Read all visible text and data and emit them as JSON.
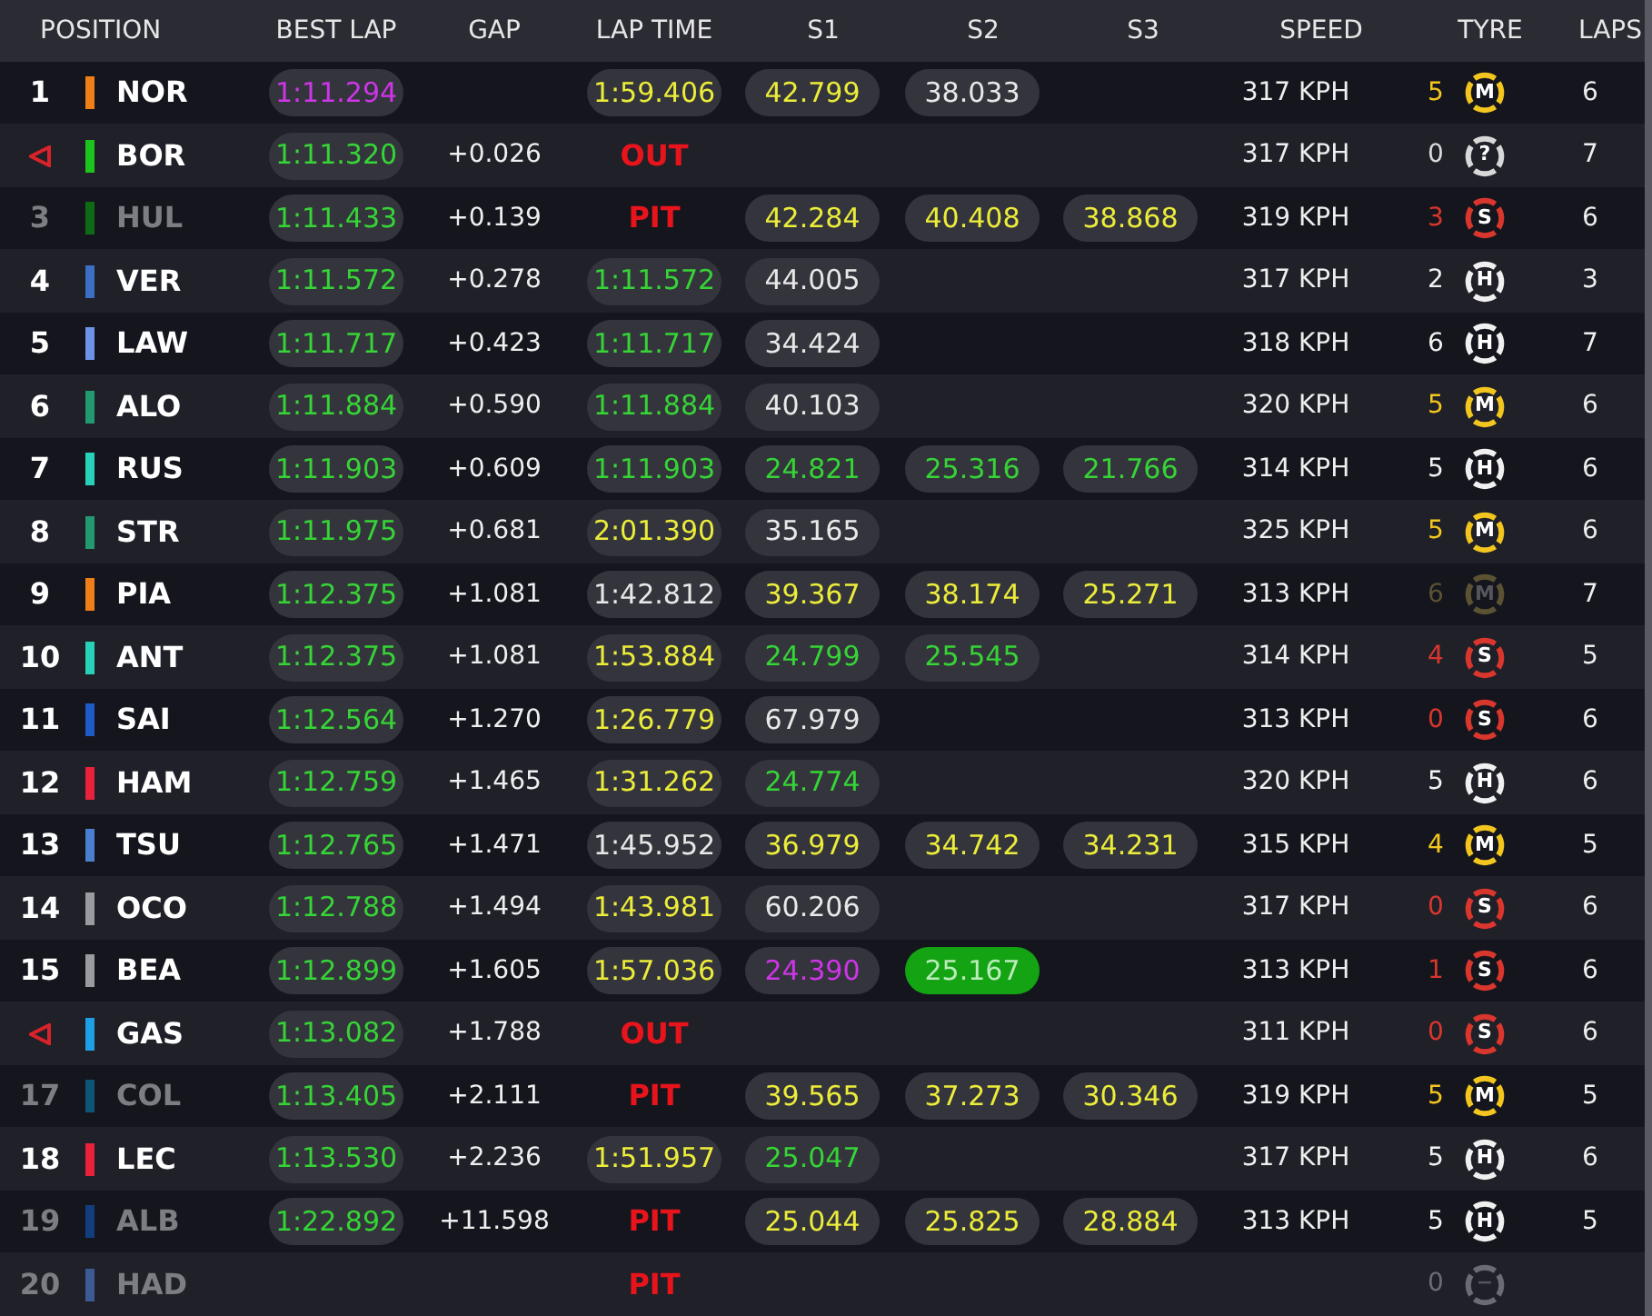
{
  "columns": [
    "POSITION",
    "BEST LAP",
    "GAP",
    "LAP TIME",
    "S1",
    "S2",
    "S3",
    "SPEED",
    "TYRE",
    "LAPS"
  ],
  "rows": [
    {
      "position": {
        "kind": "number",
        "text": "1"
      },
      "color": "#f07f1a",
      "driver": "NOR",
      "dimmed": false,
      "best_lap": {
        "text": "1:11.294",
        "kind": "fastest"
      },
      "lap_time": {
        "kind": "slower",
        "text": "1:59.406"
      },
      "s1": {
        "text": "42.799",
        "kind": "slower",
        "highlighted": false
      },
      "s2": {
        "text": "38.033",
        "kind": "plain",
        "highlighted": false
      },
      "speed": "317 KPH",
      "tyre": {
        "age": "5",
        "letter": "M",
        "color": "#f2c51f",
        "faded": false
      },
      "laps": "6"
    },
    {
      "position": {
        "kind": "triangle"
      },
      "color": "#1ec41e",
      "driver": "BOR",
      "dimmed": false,
      "best_lap": {
        "text": "1:11.320",
        "kind": "personal"
      },
      "gap": "+0.026",
      "lap_time": {
        "kind": "status",
        "text": "OUT"
      },
      "speed": "317 KPH",
      "tyre": {
        "age": "0",
        "letter": "?",
        "color": "#d8d8d8",
        "faded": false
      },
      "laps": "7"
    },
    {
      "position": {
        "kind": "number",
        "text": "3"
      },
      "color": "#0f6a16",
      "driver": "HUL",
      "dimmed": true,
      "best_lap": {
        "text": "1:11.433",
        "kind": "personal"
      },
      "gap": "+0.139",
      "lap_time": {
        "kind": "status",
        "text": "PIT"
      },
      "s1": {
        "text": "42.284",
        "kind": "slower",
        "highlighted": false
      },
      "s2": {
        "text": "40.408",
        "kind": "slower",
        "highlighted": false
      },
      "s3": {
        "text": "38.868",
        "kind": "slower",
        "highlighted": false
      },
      "speed": "319 KPH",
      "tyre": {
        "age": "3",
        "letter": "S",
        "color": "#d9362e",
        "faded": false
      },
      "laps": "6"
    },
    {
      "position": {
        "kind": "number",
        "text": "4"
      },
      "color": "#3c6fc4",
      "driver": "VER",
      "dimmed": false,
      "best_lap": {
        "text": "1:11.572",
        "kind": "personal"
      },
      "gap": "+0.278",
      "lap_time": {
        "kind": "personal",
        "text": "1:11.572"
      },
      "s1": {
        "text": "44.005",
        "kind": "plain",
        "highlighted": false
      },
      "speed": "317 KPH",
      "tyre": {
        "age": "2",
        "letter": "H",
        "color": "#f0f0f0",
        "faded": false
      },
      "laps": "3"
    },
    {
      "position": {
        "kind": "number",
        "text": "5"
      },
      "color": "#6e92e8",
      "driver": "LAW",
      "dimmed": false,
      "best_lap": {
        "text": "1:11.717",
        "kind": "personal"
      },
      "gap": "+0.423",
      "lap_time": {
        "kind": "personal",
        "text": "1:11.717"
      },
      "s1": {
        "text": "34.424",
        "kind": "plain",
        "highlighted": false
      },
      "speed": "318 KPH",
      "tyre": {
        "age": "6",
        "letter": "H",
        "color": "#f0f0f0",
        "faded": false
      },
      "laps": "7"
    },
    {
      "position": {
        "kind": "number",
        "text": "6"
      },
      "color": "#229971",
      "driver": "ALO",
      "dimmed": false,
      "best_lap": {
        "text": "1:11.884",
        "kind": "personal"
      },
      "gap": "+0.590",
      "lap_time": {
        "kind": "personal",
        "text": "1:11.884"
      },
      "s1": {
        "text": "40.103",
        "kind": "plain",
        "highlighted": false
      },
      "speed": "320 KPH",
      "tyre": {
        "age": "5",
        "letter": "M",
        "color": "#f2c51f",
        "faded": false
      },
      "laps": "6"
    },
    {
      "position": {
        "kind": "number",
        "text": "7"
      },
      "color": "#27d2b8",
      "driver": "RUS",
      "dimmed": false,
      "best_lap": {
        "text": "1:11.903",
        "kind": "personal"
      },
      "gap": "+0.609",
      "lap_time": {
        "kind": "personal",
        "text": "1:11.903"
      },
      "s1": {
        "text": "24.821",
        "kind": "personal",
        "highlighted": false
      },
      "s2": {
        "text": "25.316",
        "kind": "personal",
        "highlighted": false
      },
      "s3": {
        "text": "21.766",
        "kind": "personal",
        "highlighted": false
      },
      "speed": "314 KPH",
      "tyre": {
        "age": "5",
        "letter": "H",
        "color": "#f0f0f0",
        "faded": false
      },
      "laps": "6"
    },
    {
      "position": {
        "kind": "number",
        "text": "8"
      },
      "color": "#229971",
      "driver": "STR",
      "dimmed": false,
      "best_lap": {
        "text": "1:11.975",
        "kind": "personal"
      },
      "gap": "+0.681",
      "lap_time": {
        "kind": "slower",
        "text": "2:01.390"
      },
      "s1": {
        "text": "35.165",
        "kind": "plain",
        "highlighted": false
      },
      "speed": "325 KPH",
      "tyre": {
        "age": "5",
        "letter": "M",
        "color": "#f2c51f",
        "faded": false
      },
      "laps": "6"
    },
    {
      "position": {
        "kind": "number",
        "text": "9"
      },
      "color": "#f07f1a",
      "driver": "PIA",
      "dimmed": false,
      "best_lap": {
        "text": "1:12.375",
        "kind": "personal"
      },
      "gap": "+1.081",
      "lap_time": {
        "kind": "plain",
        "text": "1:42.812"
      },
      "s1": {
        "text": "39.367",
        "kind": "slower",
        "highlighted": false
      },
      "s2": {
        "text": "38.174",
        "kind": "slower",
        "highlighted": false
      },
      "s3": {
        "text": "25.271",
        "kind": "slower",
        "highlighted": false
      },
      "speed": "313 KPH",
      "tyre": {
        "age": "6",
        "letter": "M",
        "color": "#5b5233",
        "faded": true
      },
      "laps": "7"
    },
    {
      "position": {
        "kind": "number",
        "text": "10"
      },
      "color": "#27d2b8",
      "driver": "ANT",
      "dimmed": false,
      "best_lap": {
        "text": "1:12.375",
        "kind": "personal"
      },
      "gap": "+1.081",
      "lap_time": {
        "kind": "slower",
        "text": "1:53.884"
      },
      "s1": {
        "text": "24.799",
        "kind": "personal",
        "highlighted": false
      },
      "s2": {
        "text": "25.545",
        "kind": "personal",
        "highlighted": false
      },
      "speed": "314 KPH",
      "tyre": {
        "age": "4",
        "letter": "S",
        "color": "#d9362e",
        "faded": false
      },
      "laps": "5"
    },
    {
      "position": {
        "kind": "number",
        "text": "11"
      },
      "color": "#1e5bc6",
      "driver": "SAI",
      "dimmed": false,
      "best_lap": {
        "text": "1:12.564",
        "kind": "personal"
      },
      "gap": "+1.270",
      "lap_time": {
        "kind": "slower",
        "text": "1:26.779"
      },
      "s1": {
        "text": "67.979",
        "kind": "plain",
        "highlighted": false
      },
      "speed": "313 KPH",
      "tyre": {
        "age": "0",
        "letter": "S",
        "color": "#d9362e",
        "faded": false
      },
      "laps": "6"
    },
    {
      "position": {
        "kind": "number",
        "text": "12"
      },
      "color": "#e8213c",
      "driver": "HAM",
      "dimmed": false,
      "best_lap": {
        "text": "1:12.759",
        "kind": "personal"
      },
      "gap": "+1.465",
      "lap_time": {
        "kind": "slower",
        "text": "1:31.262"
      },
      "s1": {
        "text": "24.774",
        "kind": "personal",
        "highlighted": false
      },
      "speed": "320 KPH",
      "tyre": {
        "age": "5",
        "letter": "H",
        "color": "#f0f0f0",
        "faded": false
      },
      "laps": "6"
    },
    {
      "position": {
        "kind": "number",
        "text": "13"
      },
      "color": "#4a7fd0",
      "driver": "TSU",
      "dimmed": false,
      "best_lap": {
        "text": "1:12.765",
        "kind": "personal"
      },
      "gap": "+1.471",
      "lap_time": {
        "kind": "plain",
        "text": "1:45.952"
      },
      "s1": {
        "text": "36.979",
        "kind": "slower",
        "highlighted": false
      },
      "s2": {
        "text": "34.742",
        "kind": "slower",
        "highlighted": false
      },
      "s3": {
        "text": "34.231",
        "kind": "slower",
        "highlighted": false
      },
      "speed": "315 KPH",
      "tyre": {
        "age": "4",
        "letter": "M",
        "color": "#f2c51f",
        "faded": false
      },
      "laps": "5"
    },
    {
      "position": {
        "kind": "number",
        "text": "14"
      },
      "color": "#9a9ba0",
      "driver": "OCO",
      "dimmed": false,
      "best_lap": {
        "text": "1:12.788",
        "kind": "personal"
      },
      "gap": "+1.494",
      "lap_time": {
        "kind": "slower",
        "text": "1:43.981"
      },
      "s1": {
        "text": "60.206",
        "kind": "plain",
        "highlighted": false
      },
      "speed": "317 KPH",
      "tyre": {
        "age": "0",
        "letter": "S",
        "color": "#d9362e",
        "faded": false
      },
      "laps": "6"
    },
    {
      "position": {
        "kind": "number",
        "text": "15"
      },
      "color": "#9a9ba1",
      "driver": "BEA",
      "dimmed": false,
      "best_lap": {
        "text": "1:12.899",
        "kind": "personal"
      },
      "gap": "+1.605",
      "lap_time": {
        "kind": "slower",
        "text": "1:57.036"
      },
      "s1": {
        "text": "24.390",
        "kind": "fastest",
        "highlighted": false
      },
      "s2": {
        "text": "25.167",
        "kind": "personal",
        "highlighted": true
      },
      "speed": "313 KPH",
      "tyre": {
        "age": "1",
        "letter": "S",
        "color": "#d9362e",
        "faded": false
      },
      "laps": "6"
    },
    {
      "position": {
        "kind": "triangle"
      },
      "color": "#1f9fe6",
      "driver": "GAS",
      "dimmed": false,
      "best_lap": {
        "text": "1:13.082",
        "kind": "personal"
      },
      "gap": "+1.788",
      "lap_time": {
        "kind": "status",
        "text": "OUT"
      },
      "speed": "311 KPH",
      "tyre": {
        "age": "0",
        "letter": "S",
        "color": "#d9362e",
        "faded": false
      },
      "laps": "6"
    },
    {
      "position": {
        "kind": "number",
        "text": "17"
      },
      "color": "#0d5577",
      "driver": "COL",
      "dimmed": true,
      "best_lap": {
        "text": "1:13.405",
        "kind": "personal"
      },
      "gap": "+2.111",
      "lap_time": {
        "kind": "status",
        "text": "PIT"
      },
      "s1": {
        "text": "39.565",
        "kind": "slower",
        "highlighted": false
      },
      "s2": {
        "text": "37.273",
        "kind": "slower",
        "highlighted": false
      },
      "s3": {
        "text": "30.346",
        "kind": "slower",
        "highlighted": false
      },
      "speed": "319 KPH",
      "tyre": {
        "age": "5",
        "letter": "M",
        "color": "#f2c51f",
        "faded": false
      },
      "laps": "5"
    },
    {
      "position": {
        "kind": "number",
        "text": "18"
      },
      "color": "#e8213d",
      "driver": "LEC",
      "dimmed": false,
      "best_lap": {
        "text": "1:13.530",
        "kind": "personal"
      },
      "gap": "+2.236",
      "lap_time": {
        "kind": "slower",
        "text": "1:51.957"
      },
      "s1": {
        "text": "25.047",
        "kind": "personal",
        "highlighted": false
      },
      "speed": "317 KPH",
      "tyre": {
        "age": "5",
        "letter": "H",
        "color": "#f0f0f0",
        "faded": false
      },
      "laps": "6"
    },
    {
      "position": {
        "kind": "number",
        "text": "19"
      },
      "color": "#123e80",
      "driver": "ALB",
      "dimmed": true,
      "best_lap": {
        "text": "1:22.892",
        "kind": "personal"
      },
      "gap": "+11.598",
      "lap_time": {
        "kind": "status",
        "text": "PIT"
      },
      "s1": {
        "text": "25.044",
        "kind": "slower",
        "highlighted": false
      },
      "s2": {
        "text": "25.825",
        "kind": "slower",
        "highlighted": false
      },
      "s3": {
        "text": "28.884",
        "kind": "slower",
        "highlighted": false
      },
      "speed": "313 KPH",
      "tyre": {
        "age": "5",
        "letter": "H",
        "color": "#f0f0f0",
        "faded": false
      },
      "laps": "5"
    },
    {
      "position": {
        "kind": "number",
        "text": "20"
      },
      "color": "#3c5a94",
      "driver": "HAD",
      "dimmed": true,
      "lap_time": {
        "kind": "status",
        "text": "PIT"
      },
      "tyre": {
        "age": "0",
        "letter": "−",
        "color": "#6a6b73",
        "faded": true
      }
    }
  ]
}
